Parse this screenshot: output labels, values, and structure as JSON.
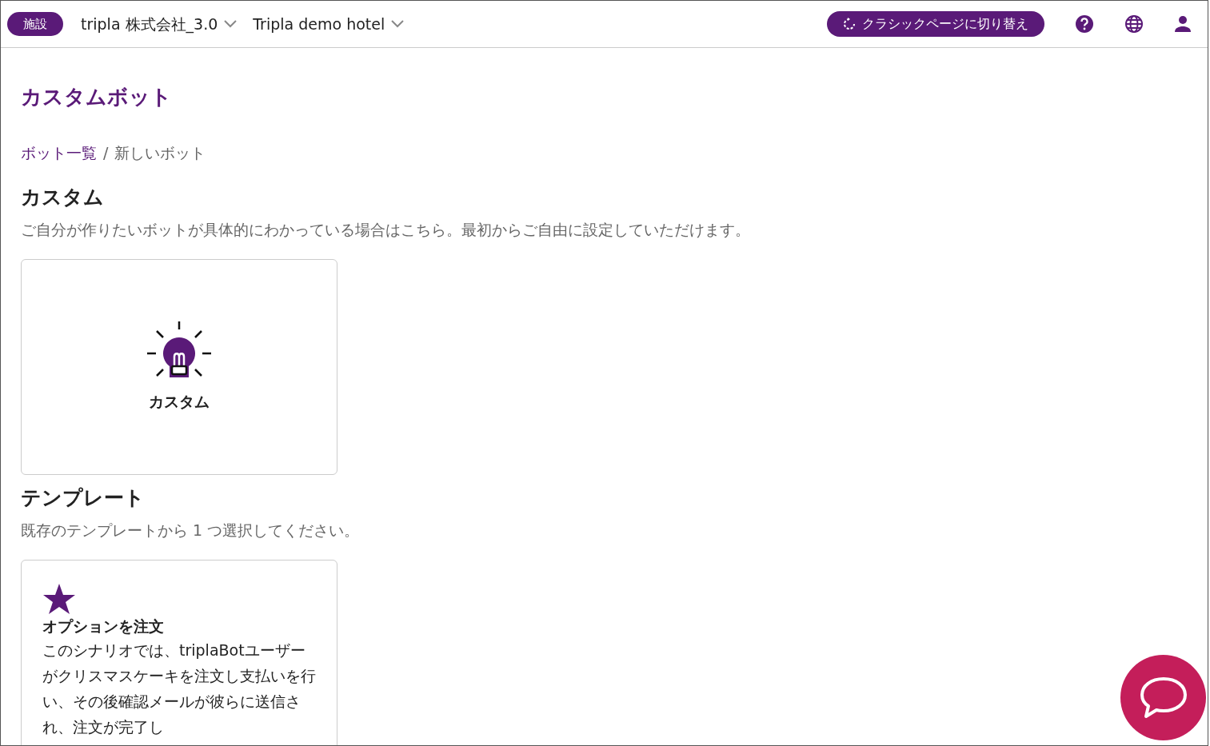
{
  "header": {
    "facility_badge": "施設",
    "company": "tripla 株式会社_3.0",
    "hotel": "Tripla demo hotel",
    "switch_button": "クラシックページに切り替え"
  },
  "page_title": "カスタムボット",
  "breadcrumb_separator": "/",
  "breadcrumb": [
    {
      "label": "ボット一覧",
      "link": true
    },
    {
      "label": "新しいボット",
      "link": false
    }
  ],
  "sections": [
    {
      "heading": "カスタム",
      "description": "ご自分が作りたいボットが具体的にわかっている場合はこちら。最初からご自由に設定していただけます。",
      "cards": [
        {
          "kind": "custom",
          "title": "カスタム"
        }
      ]
    },
    {
      "heading": "テンプレート",
      "description": "既存のテンプレートから 1 つ選択してください。",
      "cards": [
        {
          "kind": "template",
          "title": "オプションを注文",
          "text": "このシナリオでは、triplaBotユーザーがクリスマスケーキを注文し支払いを行い、その後確認メールが彼らに送信され、注文が完了し"
        }
      ]
    }
  ]
}
